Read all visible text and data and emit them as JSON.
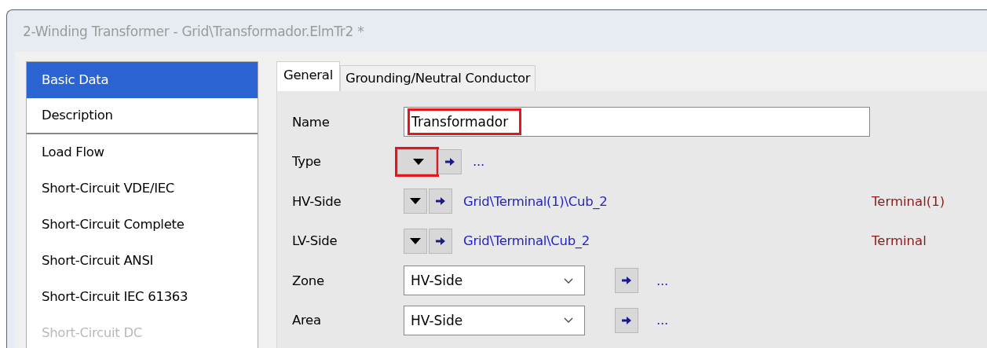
{
  "window": {
    "title": "2-Winding Transformer - Grid\\Transformador.ElmTr2 *"
  },
  "sidebar": {
    "items": [
      {
        "label": "Basic Data",
        "selected": true,
        "disabled": false,
        "divider": false
      },
      {
        "label": "Description",
        "selected": false,
        "disabled": false,
        "divider": true
      },
      {
        "label": "Load Flow",
        "selected": false,
        "disabled": false,
        "divider": false
      },
      {
        "label": "Short-Circuit VDE/IEC",
        "selected": false,
        "disabled": false,
        "divider": false
      },
      {
        "label": "Short-Circuit Complete",
        "selected": false,
        "disabled": false,
        "divider": false
      },
      {
        "label": "Short-Circuit ANSI",
        "selected": false,
        "disabled": false,
        "divider": false
      },
      {
        "label": "Short-Circuit IEC 61363",
        "selected": false,
        "disabled": false,
        "divider": false
      },
      {
        "label": "Short-Circuit DC",
        "selected": false,
        "disabled": true,
        "divider": false
      }
    ]
  },
  "tabs": [
    {
      "label": "General",
      "selected": true
    },
    {
      "label": "Grounding/Neutral Conductor",
      "selected": false
    }
  ],
  "fields": [
    {
      "kind": "text",
      "label": "Name",
      "value": "Transformador",
      "highlighted": true
    },
    {
      "kind": "ref",
      "label": "Type",
      "link": "...",
      "highlighted": true
    },
    {
      "kind": "ref",
      "label": "HV-Side",
      "link": "Grid\\Terminal(1)\\Cub_2",
      "target": "Terminal(1)",
      "highlighted": false
    },
    {
      "kind": "ref",
      "label": "LV-Side",
      "link": "Grid\\Terminal\\Cub_2",
      "target": "Terminal",
      "highlighted": false
    },
    {
      "kind": "select",
      "label": "Zone",
      "value": "HV-Side",
      "link": "..."
    },
    {
      "kind": "select",
      "label": "Area",
      "value": "HV-Side",
      "link": "..."
    }
  ]
}
